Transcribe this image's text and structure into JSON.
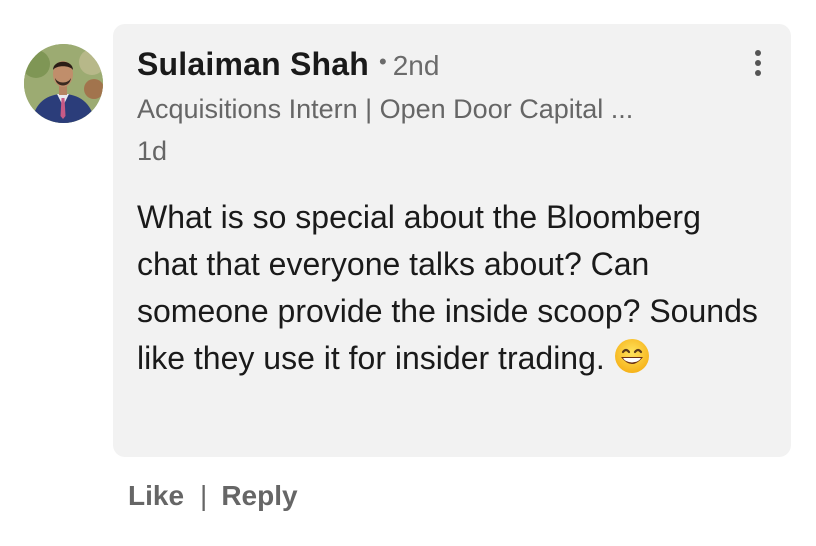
{
  "comment": {
    "author_name": "Sulaiman Shah",
    "separator_dot": "•",
    "connection_degree": "2nd",
    "headline": "Acquisitions Intern | Open Door Capital ...",
    "timestamp": "1d",
    "body": "What is so special about the Bloomberg chat that everyone talks about? Can someone provide the inside scoop? Sounds like they use it for insider trading.",
    "emoji": "grinning-face-with-smiling-eyes"
  },
  "actions": {
    "like_label": "Like",
    "divider": "|",
    "reply_label": "Reply"
  },
  "icons": {
    "more_menu": "more-vertical-icon"
  },
  "colors": {
    "bubble_bg": "#f2f2f2",
    "text_primary": "#1a1a1a",
    "text_secondary": "#666666"
  }
}
